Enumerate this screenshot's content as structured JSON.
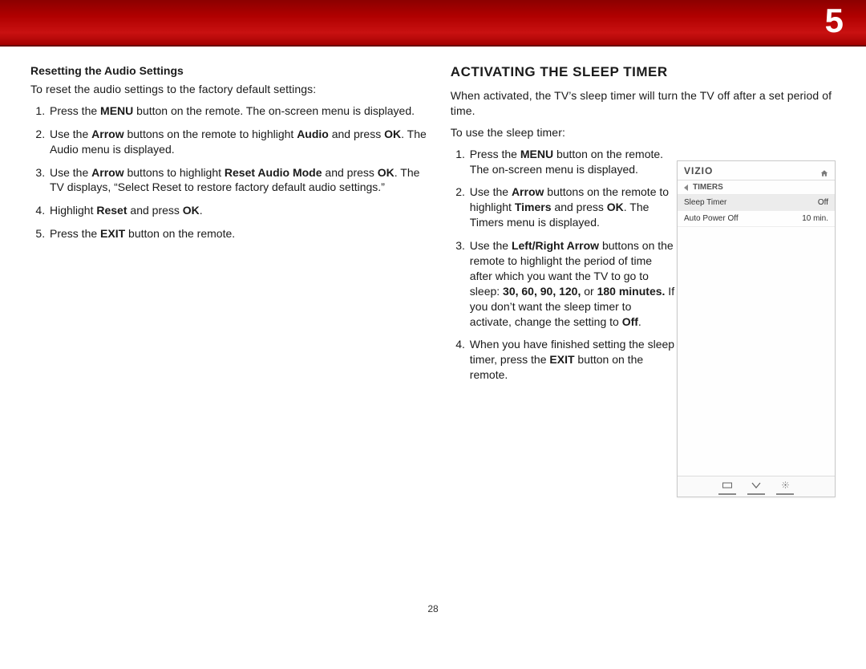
{
  "chapter_number": "5",
  "page_number": "28",
  "left": {
    "sub_head": "Resetting the Audio Settings",
    "intro": "To reset the audio settings to the factory default settings:",
    "steps": {
      "s1a": "Press the ",
      "s1b": "MENU",
      "s1c": " button on the remote. The on-screen menu is displayed.",
      "s2a": "Use the ",
      "s2b": "Arrow",
      "s2c": " buttons on the remote to highlight ",
      "s2d": "Audio",
      "s2e": " and press ",
      "s2f": "OK",
      "s2g": ". The Audio menu is displayed.",
      "s3a": "Use the ",
      "s3b": "Arrow",
      "s3c": " buttons to highlight ",
      "s3d": "Reset Audio Mode",
      "s3e": " and press ",
      "s3f": "OK",
      "s3g": ". The TV displays, “Select Reset to restore factory default audio settings.”",
      "s4a": "Highlight ",
      "s4b": "Reset",
      "s4c": " and press ",
      "s4d": "OK",
      "s4e": ".",
      "s5a": "Press the ",
      "s5b": "EXIT",
      "s5c": " button on the remote."
    }
  },
  "right": {
    "section_title": "ACTIVATING THE SLEEP TIMER",
    "intro1": "When activated, the TV’s sleep timer will turn the TV off after a set period of time.",
    "intro2": "To use the sleep timer:",
    "steps": {
      "s1a": "Press the ",
      "s1b": "MENU",
      "s1c": " button on the remote. The on-screen menu is displayed.",
      "s2a": "Use the ",
      "s2b": "Arrow",
      "s2c": " buttons on the remote to highlight ",
      "s2d": "Timers",
      "s2e": " and press ",
      "s2f": "OK",
      "s2g": ". The Timers menu is displayed.",
      "s3a": "Use the ",
      "s3b": "Left/Right Arrow",
      "s3c": " buttons on the remote to highlight the period of time after which you want the TV to go to sleep: ",
      "s3d": "30, 60, 90, 120,",
      "s3e": " or ",
      "s3f": "180 minutes.",
      "s3g": " If you don’t want the sleep timer to activate, change the setting to ",
      "s3h": "Off",
      "s3i": ".",
      "s4a": "When you have finished setting the sleep timer, press the ",
      "s4b": "EXIT",
      "s4c": " button on the remote."
    }
  },
  "inset": {
    "logo": "VIZIO",
    "crumb": "TIMERS",
    "rows": [
      {
        "label": "Sleep Timer",
        "value": "Off"
      },
      {
        "label": "Auto Power Off",
        "value": "10 min."
      }
    ]
  }
}
